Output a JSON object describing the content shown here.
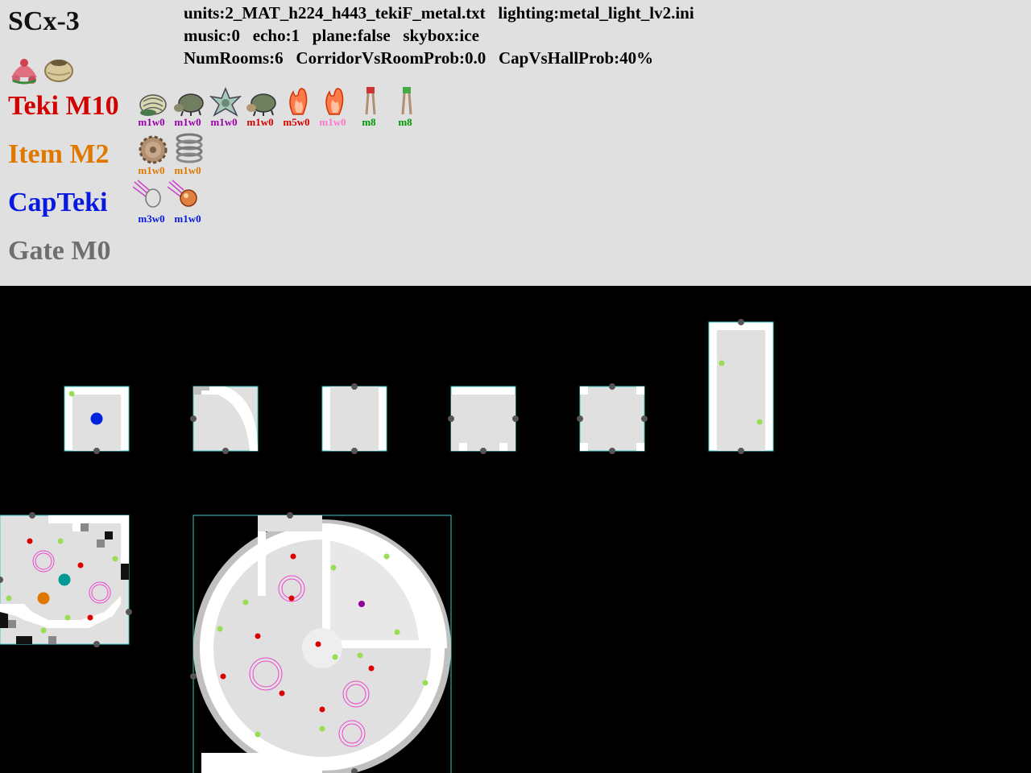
{
  "sublevel_title": "SCx-3",
  "info_lines": [
    "units:2_MAT_h224_h443_tekiF_metal.txt   lighting:metal_light_lv2.ini",
    "music:0   echo:1   plane:false   skybox:ice",
    "NumRooms:6   CorridorVsRoomProb:0.0   CapVsHallProb:40%"
  ],
  "treasure_icons": [
    "flower-treasure-icon",
    "pot-treasure-icon"
  ],
  "categories": {
    "teki": {
      "label": "Teki M10",
      "color": "#d40000"
    },
    "item": {
      "label": "Item M2",
      "color": "#e07800"
    },
    "capteki": {
      "label": "CapTeki",
      "color": "#0a19e0"
    },
    "gate": {
      "label": "Gate M0",
      "color": "#6e6e6e"
    }
  },
  "teki_list": [
    {
      "icon": "snail-shell-icon",
      "label": "m1w0",
      "color": "#9900aa"
    },
    {
      "icon": "beetle-icon",
      "label": "m1w0",
      "color": "#9900aa"
    },
    {
      "icon": "star-crab-icon",
      "label": "m1w0",
      "color": "#9900aa"
    },
    {
      "icon": "beetle-icon",
      "label": "m1w0",
      "color": "#d40000"
    },
    {
      "icon": "fire-geyser-icon",
      "label": "m5w0",
      "color": "#d40000"
    },
    {
      "icon": "fire-geyser-icon",
      "label": "m1w0",
      "color": "#ff77cc"
    },
    {
      "icon": "red-stalk-plant-icon",
      "label": "m8",
      "color": "#009900"
    },
    {
      "icon": "green-stalk-plant-icon",
      "label": "m8",
      "color": "#009900"
    }
  ],
  "item_list": [
    {
      "icon": "gear-treasure-icon",
      "label": "m1w0",
      "color": "#e07800"
    },
    {
      "icon": "spring-treasure-icon",
      "label": "m1w0",
      "color": "#e07800"
    }
  ],
  "capteki_list": [
    {
      "icon": "falling-egg-icon",
      "label": "m3w0",
      "color": "#0a19e0"
    },
    {
      "icon": "falling-bomb-icon",
      "label": "m1w0",
      "color": "#0a19e0"
    }
  ],
  "map_units": [
    {
      "name": "cap-unit-start",
      "type": "cap"
    },
    {
      "name": "cap-unit-curve",
      "type": "curve"
    },
    {
      "name": "hall-straight-unit",
      "type": "straight"
    },
    {
      "name": "hall-tee-unit",
      "type": "tee"
    },
    {
      "name": "hall-cross-unit",
      "type": "cross"
    },
    {
      "name": "hall-long-unit",
      "type": "long"
    },
    {
      "name": "room-small-unit",
      "type": "room-small"
    },
    {
      "name": "room-round-unit",
      "type": "room-round"
    }
  ],
  "colors": {
    "header_bg": "#e0e0e0",
    "map_bg": "#000000",
    "unit_border": "#33cccc",
    "floor_light": "#e0e0e0",
    "floor_white": "#ffffff",
    "door": "#555555",
    "spawn_teki": "#dd0000",
    "spawn_plant": "#99dd55",
    "spawn_ship": "#0022dd",
    "spawn_item": "#e07800",
    "spawn_cap": "#009999",
    "spawn_special": "#990099",
    "geyser_ring": "#ee44cc"
  }
}
